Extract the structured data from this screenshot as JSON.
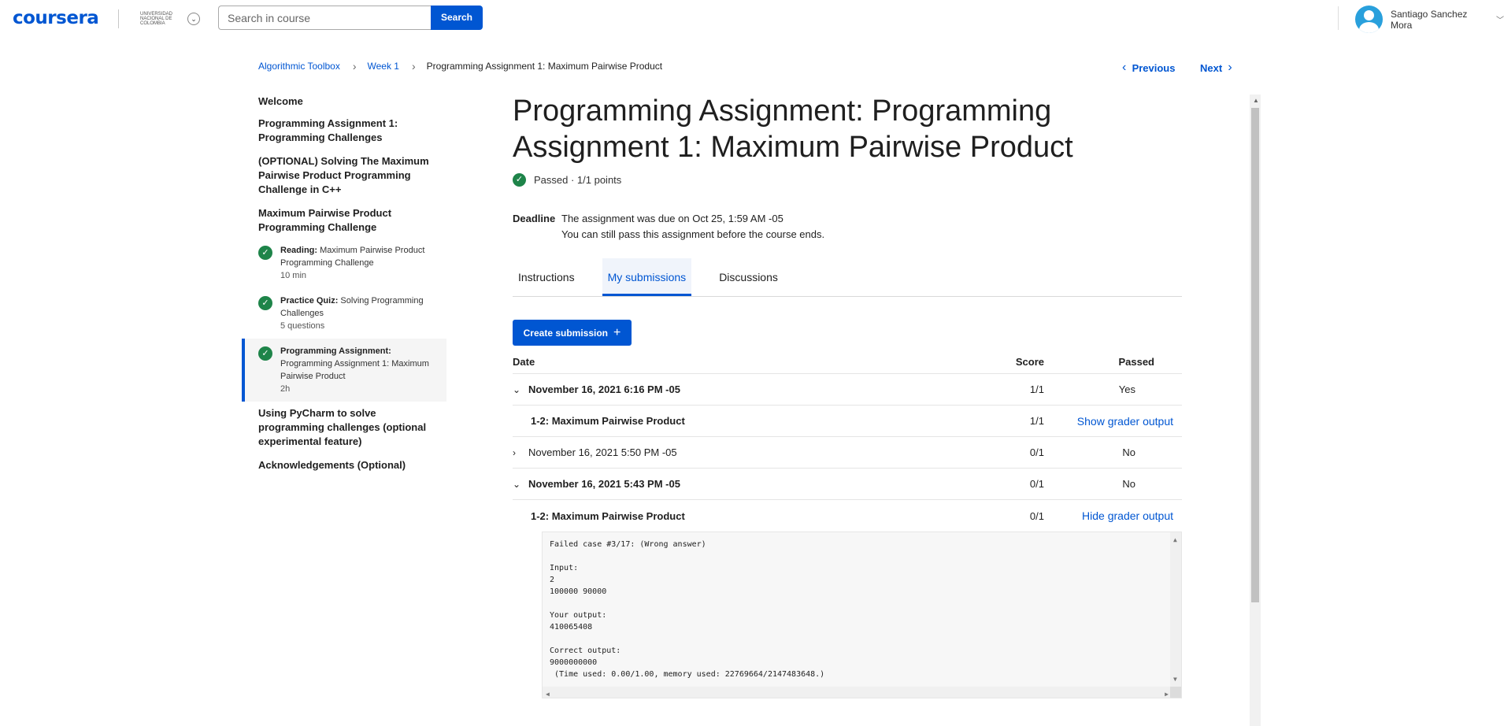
{
  "header": {
    "logo": "coursera",
    "partner_text": "UNIVERSIDAD NACIONAL DE COLOMBIA",
    "search_placeholder": "Search in course",
    "search_button": "Search",
    "user_name": "Santiago Sanchez Mora"
  },
  "breadcrumb": {
    "items": [
      "Algorithmic Toolbox",
      "Week 1",
      "Programming Assignment 1: Maximum Pairwise Product"
    ],
    "previous": "Previous",
    "next": "Next"
  },
  "sidebar": {
    "welcome": "Welcome",
    "section1": "Programming Assignment 1: Programming Challenges",
    "section2": "(OPTIONAL) Solving The Maximum Pairwise Product Programming Challenge in C++",
    "section3": "Maximum Pairwise Product Programming Challenge",
    "items": [
      {
        "type": "Reading:",
        "title": "Maximum Pairwise Product Programming Challenge",
        "meta": "10 min"
      },
      {
        "type": "Practice Quiz:",
        "title": "Solving Programming Challenges",
        "meta": "5 questions"
      },
      {
        "type": "Programming Assignment:",
        "title": "Programming Assignment 1: Maximum Pairwise Product",
        "meta": "2h"
      }
    ],
    "section4": "Using PyCharm to solve programming challenges (optional experimental feature)",
    "section5": "Acknowledgements (Optional)"
  },
  "main": {
    "title": "Programming Assignment: Programming Assignment 1: Maximum Pairwise Product",
    "status": "Passed · 1/1 points",
    "deadline_label": "Deadline",
    "deadline_line1": "The assignment was due on Oct 25, 1:59 AM -05",
    "deadline_line2": "You can still pass this assignment before the course ends.",
    "tabs": [
      "Instructions",
      "My submissions",
      "Discussions"
    ],
    "create_button": "Create submission",
    "table_headers": {
      "date": "Date",
      "score": "Score",
      "passed": "Passed"
    },
    "submissions": [
      {
        "date": "November 16, 2021 6:16 PM -05",
        "score": "1/1",
        "passed": "Yes",
        "part": "1-2: Maximum Pairwise Product",
        "part_score": "1/1",
        "action": "Show grader output"
      },
      {
        "date": "November 16, 2021 5:50 PM -05",
        "score": "0/1",
        "passed": "No"
      },
      {
        "date": "November 16, 2021 5:43 PM -05",
        "score": "0/1",
        "passed": "No",
        "part": "1-2: Maximum Pairwise Product",
        "part_score": "0/1",
        "action": "Hide grader output"
      }
    ],
    "grader_output": "Failed case #3/17: (Wrong answer)\n\nInput:\n2\n100000 90000\n\nYour output:\n410065408\n\nCorrect output:\n9000000000\n (Time used: 0.00/1.00, memory used: 22769664/2147483648.)"
  },
  "colors": {
    "accent": "#0056d2",
    "success": "#1e8449"
  }
}
